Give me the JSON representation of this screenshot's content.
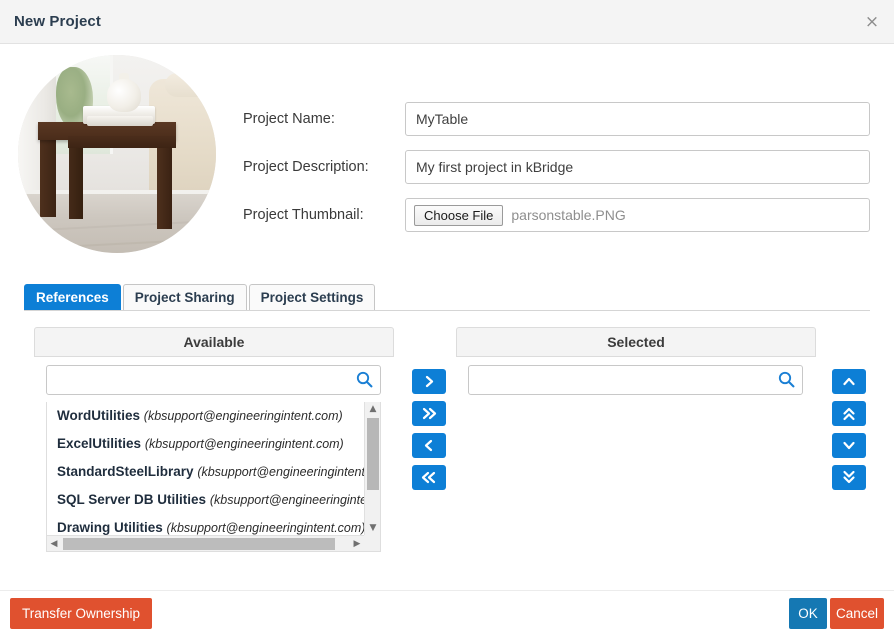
{
  "window": {
    "title": "New Project",
    "close_icon": "close-icon",
    "close_label": "×"
  },
  "thumbnail": {
    "alt": "project thumbnail photo of a dark wood side table"
  },
  "form": {
    "fields": [
      {
        "label": "Project Name:",
        "value": "MyTable",
        "placeholder": ""
      },
      {
        "label": "Project Description:",
        "value": "My first project in kBridge",
        "placeholder": ""
      }
    ],
    "thumbnail_field": {
      "label": "Project Thumbnail:",
      "choose_button": "Choose File",
      "file_name": "parsonstable.PNG"
    }
  },
  "tabs": [
    {
      "label": "References",
      "active": true
    },
    {
      "label": "Project Sharing",
      "active": false
    },
    {
      "label": "Project Settings",
      "active": false
    }
  ],
  "available_panel": {
    "title": "Available",
    "search": {
      "value": "",
      "placeholder": "",
      "icon": "search-icon"
    },
    "items": [
      {
        "name": "WordUtilities",
        "owner": "(kbsupport@engineeringintent.com)"
      },
      {
        "name": "ExcelUtilities",
        "owner": "(kbsupport@engineeringintent.com)"
      },
      {
        "name": "StandardSteelLibrary",
        "owner": "(kbsupport@engineeringintent.com)"
      },
      {
        "name": "SQL Server DB Utilities",
        "owner": "(kbsupport@engineeringintent.com)"
      },
      {
        "name": "Drawing Utilities",
        "owner": "(kbsupport@engineeringintent.com)"
      }
    ]
  },
  "selected_panel": {
    "title": "Selected",
    "search": {
      "value": "",
      "placeholder": "",
      "icon": "search-icon"
    },
    "items": []
  },
  "transfer_buttons": [
    {
      "icon": "chevron-right-icon",
      "glyph": "›"
    },
    {
      "icon": "chevron-double-right-icon",
      "glyph": "»"
    },
    {
      "icon": "chevron-left-icon",
      "glyph": "‹"
    },
    {
      "icon": "chevron-double-left-icon",
      "glyph": "«"
    }
  ],
  "order_buttons": [
    {
      "icon": "chevron-up-icon",
      "glyph": "⌃"
    },
    {
      "icon": "chevron-double-up-icon",
      "glyph": "»"
    },
    {
      "icon": "chevron-down-icon",
      "glyph": "⌄"
    },
    {
      "icon": "chevron-double-down-icon",
      "glyph": "»"
    }
  ],
  "footer": {
    "transfer_ownership": "Transfer Ownership",
    "ok": "OK",
    "cancel": "Cancel"
  },
  "colors": {
    "accent_blue": "#0d7fd6",
    "ok_blue": "#1578b3",
    "danger_orange": "#e0512f",
    "titlebar_bg": "#f4f4f4"
  },
  "scrollbars": {
    "up_glyph": "▲",
    "down_glyph": "▼",
    "left_glyph": "◀",
    "right_glyph": "▶"
  }
}
